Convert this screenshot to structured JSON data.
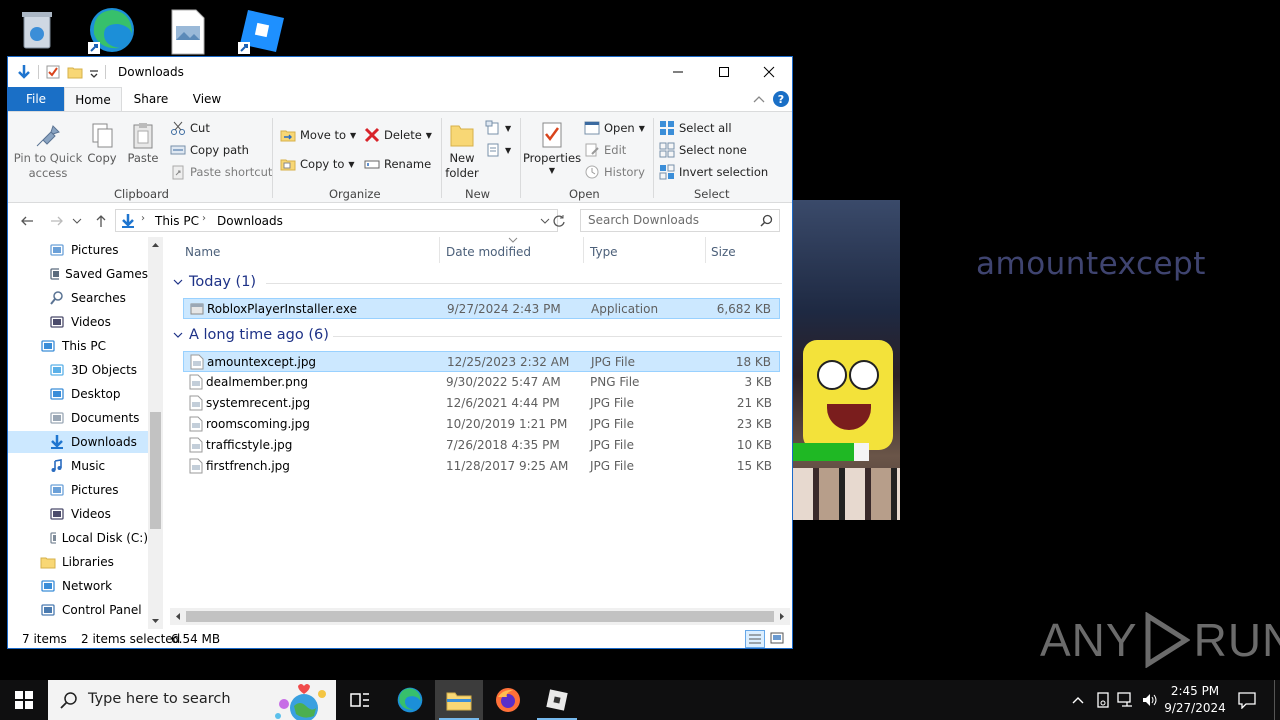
{
  "desktop": {
    "icons": [
      "recycle-bin-icon",
      "edge-icon",
      "image-file-icon",
      "roblox-studio-icon"
    ],
    "wallpaper_name": "amountexcept",
    "wallpaper_progress": 0.8,
    "watermark": "ANY RUN"
  },
  "window": {
    "title": "Downloads",
    "tabs": {
      "file": "File",
      "home": "Home",
      "share": "Share",
      "view": "View"
    },
    "ribbon": {
      "pin": "Pin to Quick access",
      "pin_line1": "Pin to Quick",
      "pin_line2": "access",
      "copy": "Copy",
      "paste": "Paste",
      "cut": "Cut",
      "copy_path": "Copy path",
      "paste_shortcut": "Paste shortcut",
      "clipboard": "Clipboard",
      "move_to": "Move to",
      "copy_to": "Copy to",
      "delete": "Delete",
      "rename": "Rename",
      "organize": "Organize",
      "new_folder_line1": "New",
      "new_folder_line2": "folder",
      "new": "New",
      "properties": "Properties",
      "open": "Open",
      "edit": "Edit",
      "history": "History",
      "open_group": "Open",
      "select_all": "Select all",
      "select_none": "Select none",
      "invert_selection": "Invert selection",
      "select": "Select"
    },
    "address": {
      "crumb1": "This PC",
      "crumb2": "Downloads",
      "search_placeholder": "Search Downloads"
    },
    "nav": [
      {
        "label": "Pictures",
        "icon": "pictures-icon",
        "indent": 1
      },
      {
        "label": "Saved Games",
        "icon": "saved-games-icon",
        "indent": 1
      },
      {
        "label": "Searches",
        "icon": "searches-icon",
        "indent": 1
      },
      {
        "label": "Videos",
        "icon": "videos-icon",
        "indent": 1
      },
      {
        "label": "This PC",
        "icon": "this-pc-icon",
        "indent": 0
      },
      {
        "label": "3D Objects",
        "icon": "3d-objects-icon",
        "indent": 1
      },
      {
        "label": "Desktop",
        "icon": "desktop-icon",
        "indent": 1
      },
      {
        "label": "Documents",
        "icon": "documents-icon",
        "indent": 1
      },
      {
        "label": "Downloads",
        "icon": "downloads-icon",
        "indent": 1,
        "selected": true
      },
      {
        "label": "Music",
        "icon": "music-icon",
        "indent": 1
      },
      {
        "label": "Pictures",
        "icon": "pictures-icon",
        "indent": 1
      },
      {
        "label": "Videos",
        "icon": "videos-icon",
        "indent": 1
      },
      {
        "label": "Local Disk (C:)",
        "icon": "local-disk-icon",
        "indent": 1
      },
      {
        "label": "Libraries",
        "icon": "libraries-icon",
        "indent": 0
      },
      {
        "label": "Network",
        "icon": "network-icon",
        "indent": 0
      },
      {
        "label": "Control Panel",
        "icon": "control-panel-icon",
        "indent": 0
      }
    ],
    "columns": {
      "name": "Name",
      "date": "Date modified",
      "type": "Type",
      "size": "Size"
    },
    "groups": [
      {
        "title": "Today (1)",
        "files": [
          {
            "name": "RobloxPlayerInstaller.exe",
            "date": "9/27/2024 2:43 PM",
            "type": "Application",
            "size": "6,682 KB",
            "selected": true,
            "icon": "exe-file-icon"
          }
        ]
      },
      {
        "title": "A long time ago (6)",
        "files": [
          {
            "name": "amountexcept.jpg",
            "date": "12/25/2023 2:32 AM",
            "type": "JPG File",
            "size": "18 KB",
            "selected": true,
            "icon": "image-file-icon"
          },
          {
            "name": "dealmember.png",
            "date": "9/30/2022 5:47 AM",
            "type": "PNG File",
            "size": "3 KB",
            "selected": false,
            "icon": "image-file-icon"
          },
          {
            "name": "systemrecent.jpg",
            "date": "12/6/2021 4:44 PM",
            "type": "JPG File",
            "size": "21 KB",
            "selected": false,
            "icon": "image-file-icon"
          },
          {
            "name": "roomscoming.jpg",
            "date": "10/20/2019 1:21 PM",
            "type": "JPG File",
            "size": "23 KB",
            "selected": false,
            "icon": "image-file-icon"
          },
          {
            "name": "trafficstyle.jpg",
            "date": "7/26/2018 4:35 PM",
            "type": "JPG File",
            "size": "10 KB",
            "selected": false,
            "icon": "image-file-icon"
          },
          {
            "name": "firstfrench.jpg",
            "date": "11/28/2017 9:25 AM",
            "type": "JPG File",
            "size": "15 KB",
            "selected": false,
            "icon": "image-file-icon"
          }
        ]
      }
    ],
    "status": {
      "count": "7 items",
      "selected": "2 items selected",
      "size": "6.54 MB"
    }
  },
  "taskbar": {
    "search_placeholder": "Type here to search",
    "time": "2:45 PM",
    "date": "9/27/2024"
  }
}
